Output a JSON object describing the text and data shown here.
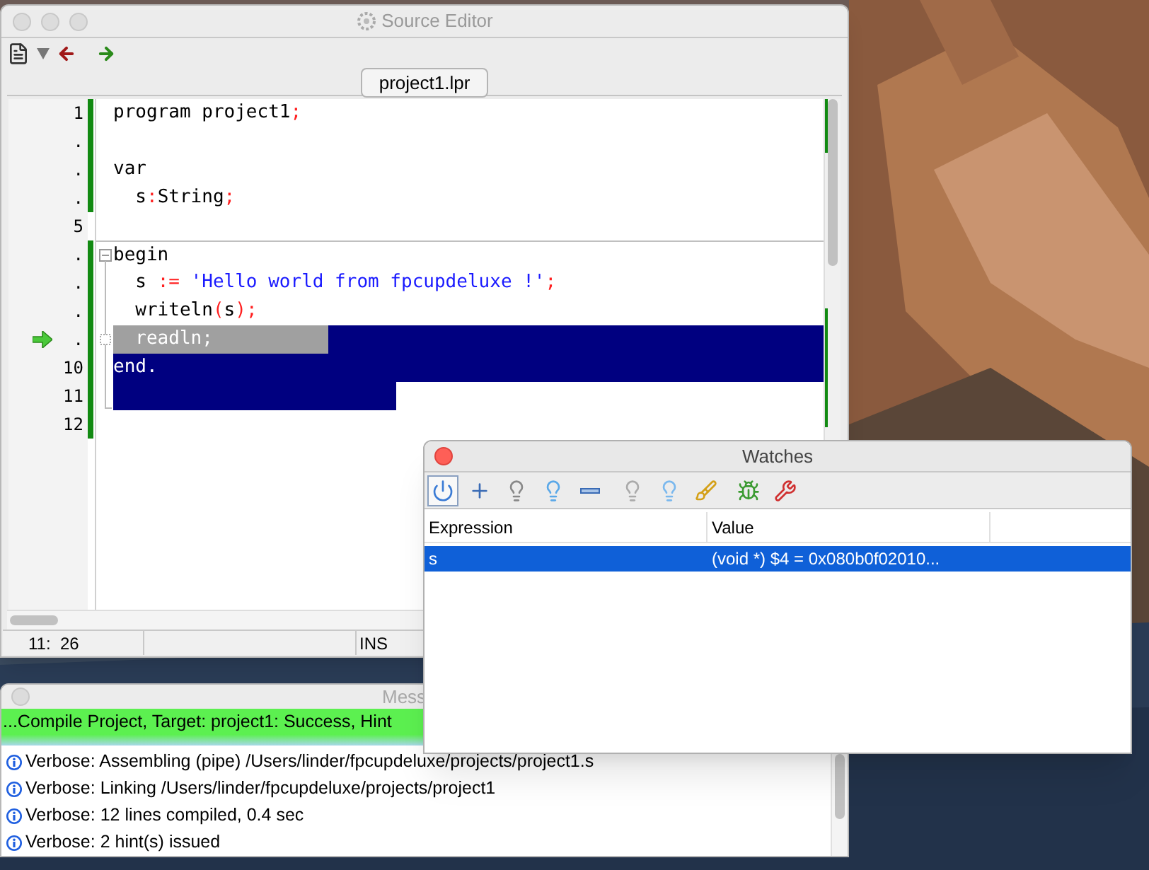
{
  "editor": {
    "title": "Source Editor",
    "tab": {
      "label": "project1.lpr",
      "selected": true
    },
    "lines": [
      {
        "gutter": "1",
        "modified": true,
        "tokens": [
          {
            "kind": "plain",
            "text": "program project1"
          },
          {
            "kind": "symbol",
            "text": ";"
          }
        ]
      },
      {
        "gutter": ".",
        "modified": true
      },
      {
        "gutter": ".",
        "modified": true,
        "tokens": [
          {
            "kind": "plain",
            "text": "var"
          }
        ]
      },
      {
        "gutter": ".",
        "modified": true,
        "tokens": [
          {
            "kind": "plain",
            "text": "  s"
          },
          {
            "kind": "symbol",
            "text": ":"
          },
          {
            "kind": "plain",
            "text": "String"
          },
          {
            "kind": "symbol",
            "text": ";"
          }
        ]
      },
      {
        "gutter": "5"
      },
      {
        "gutter": ".",
        "modified": true,
        "fold_start": true,
        "tokens": [
          {
            "kind": "plain",
            "text": "begin"
          }
        ]
      },
      {
        "gutter": ".",
        "modified": true,
        "fold_guide": true,
        "tokens": [
          {
            "kind": "plain",
            "text": "  s "
          },
          {
            "kind": "symbol",
            "text": ":= "
          },
          {
            "kind": "string",
            "text": "'Hello world from fpcupdeluxe !'"
          },
          {
            "kind": "symbol",
            "text": ";"
          }
        ]
      },
      {
        "gutter": ".",
        "modified": true,
        "fold_guide": true,
        "tokens": [
          {
            "kind": "plain",
            "text": "  writeln"
          },
          {
            "kind": "symbol",
            "text": "("
          },
          {
            "kind": "plain",
            "text": "s"
          },
          {
            "kind": "symbol",
            "text": ")"
          },
          {
            "kind": "symbol",
            "text": ";"
          }
        ]
      },
      {
        "gutter": ".",
        "modified": true,
        "fold_marker": true,
        "selected": true,
        "current": true,
        "text": "  readln;"
      },
      {
        "gutter": "10",
        "modified": true,
        "fold_guide": true,
        "selected": true,
        "text": "end."
      },
      {
        "gutter": "11",
        "modified": true,
        "fold_end": true,
        "selected": true,
        "partial": true
      },
      {
        "gutter": "12",
        "modified": true
      }
    ],
    "status": [
      "11:  26",
      "INS"
    ]
  },
  "messages": {
    "title": "Mess",
    "items": [
      {
        "kind": "success",
        "text": "...Compile Project, Target: project1: Success, Hint"
      },
      {
        "kind": "info",
        "text": "Verbose: Assembling (pipe) /Users/linder/fpcupdeluxe/projects/project1.s"
      },
      {
        "kind": "info",
        "text": "Verbose: Linking /Users/linder/fpcupdeluxe/projects/project1"
      },
      {
        "kind": "info",
        "text": "Verbose: 12 lines compiled, 0.4 sec"
      },
      {
        "kind": "info",
        "text": "Verbose: 2 hint(s) issued"
      }
    ]
  },
  "watches": {
    "title": "Watches",
    "toolbar": [
      {
        "kind": "power",
        "pressed": true
      },
      {
        "kind": "add",
        "pressed": false
      },
      {
        "kind": "bulb",
        "pressed": false
      },
      {
        "kind": "bulb-on",
        "pressed": false
      },
      {
        "kind": "remove",
        "pressed": false
      },
      {
        "kind": "bulbs",
        "pressed": false
      },
      {
        "kind": "bulbs-on",
        "pressed": false
      },
      {
        "kind": "broom",
        "pressed": false
      },
      {
        "kind": "inspect",
        "pressed": false
      },
      {
        "kind": "tools",
        "pressed": false
      }
    ],
    "columns": [
      "Expression",
      "Value"
    ],
    "rows": [
      {
        "expression": "s",
        "value": "(void *) $4 = 0x080b0f02010...",
        "selected": true
      }
    ]
  }
}
